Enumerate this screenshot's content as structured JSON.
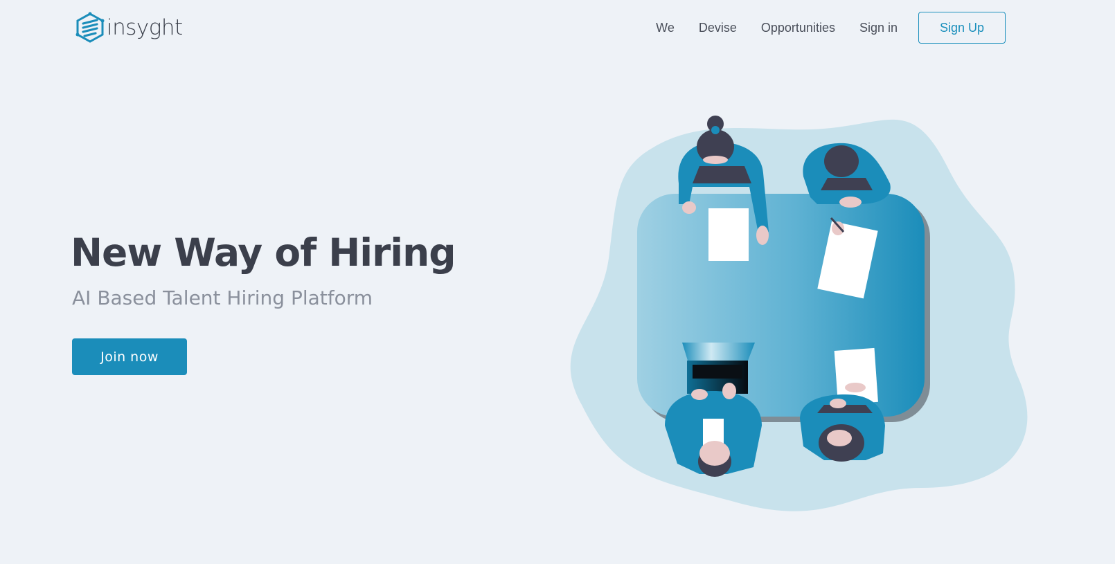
{
  "brand": {
    "name": "insyght",
    "logo_icon": "hexagon-logo-icon",
    "accent_color": "#1b8dba"
  },
  "nav": {
    "links": [
      "We",
      "Devise",
      "Opportunities",
      "Sign in"
    ],
    "signup_label": "Sign Up"
  },
  "hero": {
    "title": "New Way of Hiring",
    "subtitle": "AI Based Talent Hiring Platform",
    "cta_label": "Join now"
  },
  "illustration": {
    "description_icon": "team-meeting-table-illustration"
  }
}
